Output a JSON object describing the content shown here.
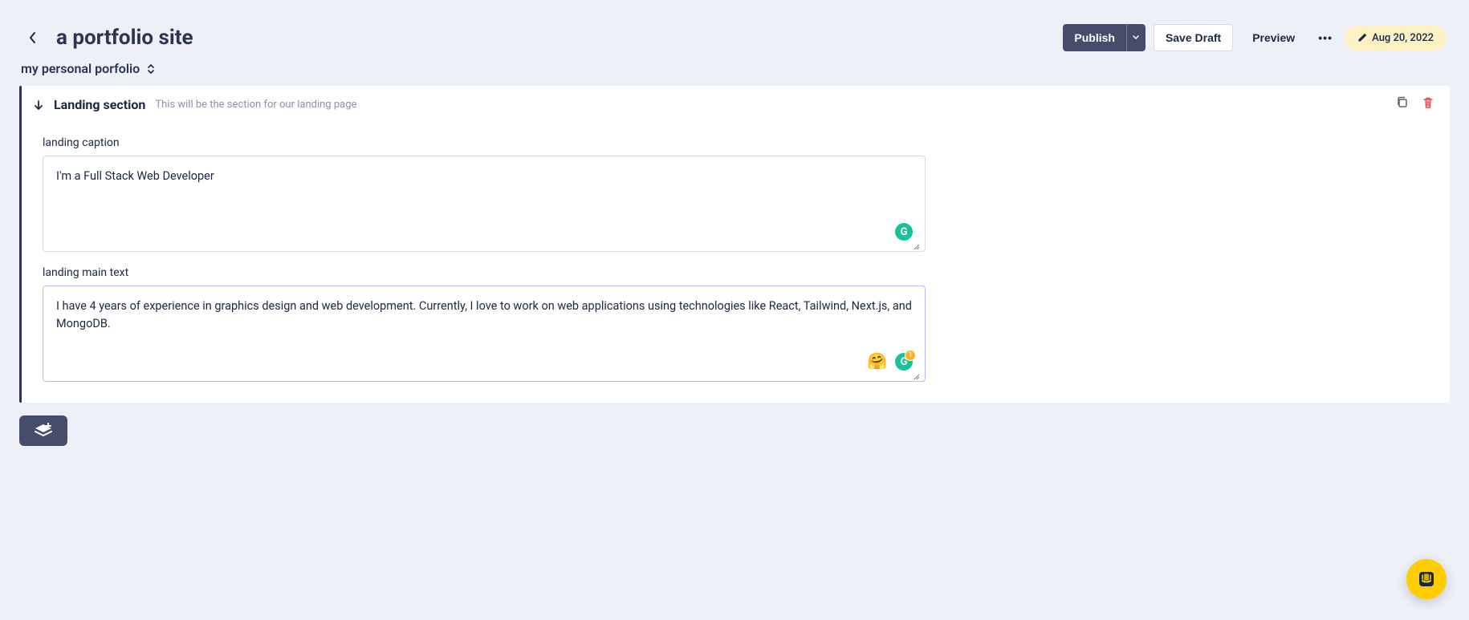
{
  "header": {
    "title": "a portfolio site",
    "publish_label": "Publish",
    "save_draft_label": "Save Draft",
    "preview_label": "Preview",
    "date": "Aug 20, 2022"
  },
  "subheader": {
    "model_label": "my personal porfolio"
  },
  "section": {
    "title": "Landing section",
    "description": "This will be the section for our landing page",
    "fields": [
      {
        "label": "landing caption",
        "value": "I'm a Full Stack Web Developer"
      },
      {
        "label": "landing main text",
        "value": "I have 4 years of experience in graphics design and web development. Currently, I love to work on web applications using technologies like React, Tailwind, Next.js, and MongoDB."
      }
    ]
  },
  "icons": {
    "grammarly_letter": "G",
    "badge_count": "1",
    "emoji": "🤗"
  }
}
